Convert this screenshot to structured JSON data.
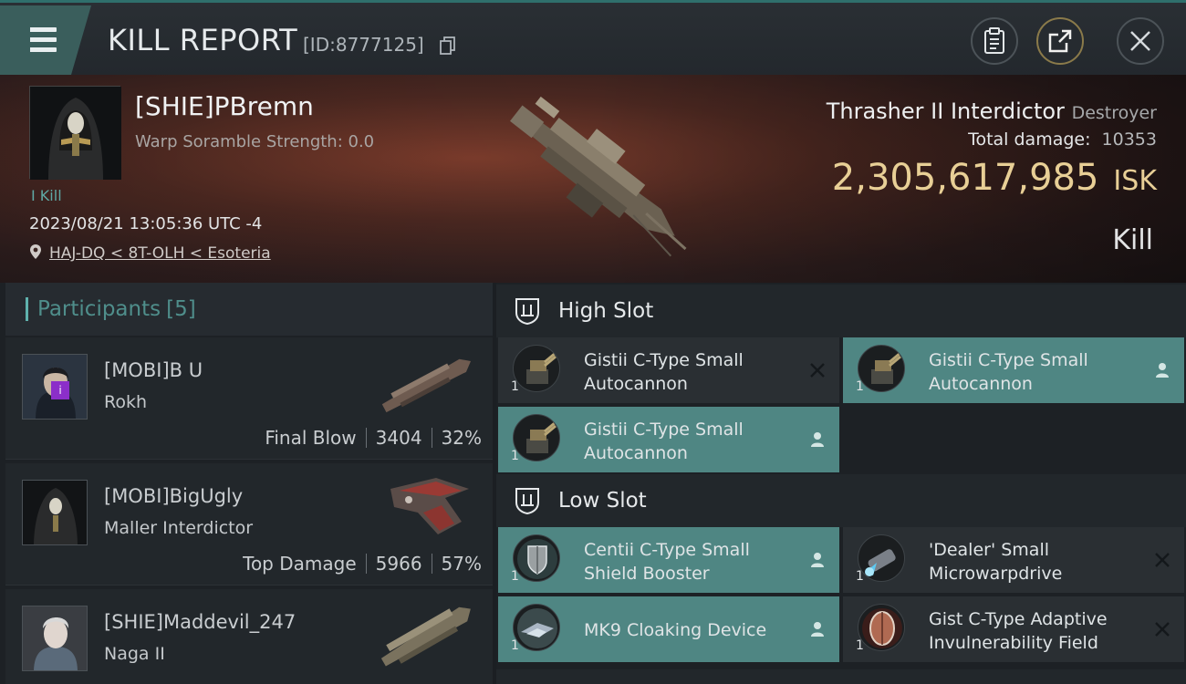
{
  "header": {
    "title": "KILL REPORT",
    "report_id": "[ID:8777125]"
  },
  "victim": {
    "name": "[SHIE]PBremn",
    "scramble": "Warp Soramble Strength: 0.0",
    "kill_tag": "I Kill",
    "datetime": "2023/08/21 13:05:36 UTC -4",
    "location": "HAJ-DQ < 8T-OLH < Esoteria",
    "ship_name": "Thrasher II Interdictor",
    "ship_category": "Destroyer",
    "total_damage_label": "Total damage:",
    "total_damage_value": "10353",
    "isk_value": "2,305,617,985",
    "isk_unit": "ISK",
    "result": "Kill"
  },
  "participants": {
    "label": "Participants",
    "count": "[5]",
    "items": [
      {
        "name": "[MOBI]B U",
        "ship": "Rokh",
        "role": "Final Blow",
        "damage": "3404",
        "percent": "32%"
      },
      {
        "name": "[MOBI]BigUgly",
        "ship": "Maller Interdictor",
        "role": "Top Damage",
        "damage": "5966",
        "percent": "57%"
      },
      {
        "name": "[SHIE]Maddevil_247",
        "ship": "Naga II",
        "role": "",
        "damage": "",
        "percent": ""
      }
    ]
  },
  "fittings": {
    "high_slot": {
      "label": "High Slot",
      "modules": [
        {
          "name": "Gistii C-Type Small Autocannon",
          "qty": "1",
          "state": "destroyed",
          "icon": "autocannon-icon"
        },
        {
          "name": "Gistii C-Type Small Autocannon",
          "qty": "1",
          "state": "dropped",
          "icon": "autocannon-icon"
        },
        {
          "name": "Gistii C-Type Small Autocannon",
          "qty": "1",
          "state": "dropped",
          "icon": "autocannon-icon"
        }
      ]
    },
    "low_slot": {
      "label": "Low Slot",
      "modules": [
        {
          "name": "Centii C-Type Small Shield Booster",
          "qty": "1",
          "state": "dropped",
          "icon": "shield-booster-icon"
        },
        {
          "name": "'Dealer' Small Microwarpdrive",
          "qty": "1",
          "state": "destroyed",
          "icon": "microwarpdrive-icon"
        },
        {
          "name": "MK9 Cloaking Device",
          "qty": "1",
          "state": "dropped",
          "icon": "cloaking-device-icon"
        },
        {
          "name": "Gist C-Type Adaptive Invulnerability Field",
          "qty": "1",
          "state": "destroyed",
          "icon": "invulnerability-field-icon"
        }
      ]
    }
  },
  "colors": {
    "accent_teal": "#4f8683",
    "isk_gold": "#e8cf96",
    "badge_purple": "#8b2fc9"
  }
}
